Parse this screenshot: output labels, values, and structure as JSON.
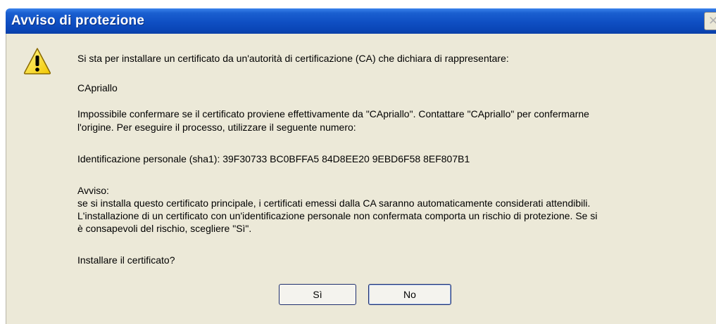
{
  "dialog": {
    "title": "Avviso di protezione",
    "close_icon": "close-icon",
    "warning_icon": "warning-icon"
  },
  "content": {
    "intro": "Si sta per installare un certificato da un'autorità di certificazione (CA) che dichiara di rappresentare:",
    "ca_name": "CApriallo",
    "verify_line1": "Impossibile confermare se il certificato proviene effettivamente da \"CApriallo\". Contattare \"CApriallo\" per confermarne",
    "verify_line2": "l'origine. Per eseguire il processo, utilizzare il seguente numero:",
    "thumbprint": "Identificazione personale (sha1): 39F30733 BC0BFFA5 84D8EE20 9EBD6F58 8EF807B1",
    "warning_heading": "Avviso:",
    "warning_line1": "se si installa questo certificato principale, i certificati emessi dalla CA saranno automaticamente considerati attendibili.",
    "warning_line2": "L'installazione di un certificato con un'identificazione personale non confermata comporta un rischio di protezione. Se si",
    "warning_line3": "è consapevoli del rischio, scegliere \"Sì\".",
    "question": "Installare il certificato?"
  },
  "buttons": {
    "yes": "Sì",
    "no": "No"
  }
}
